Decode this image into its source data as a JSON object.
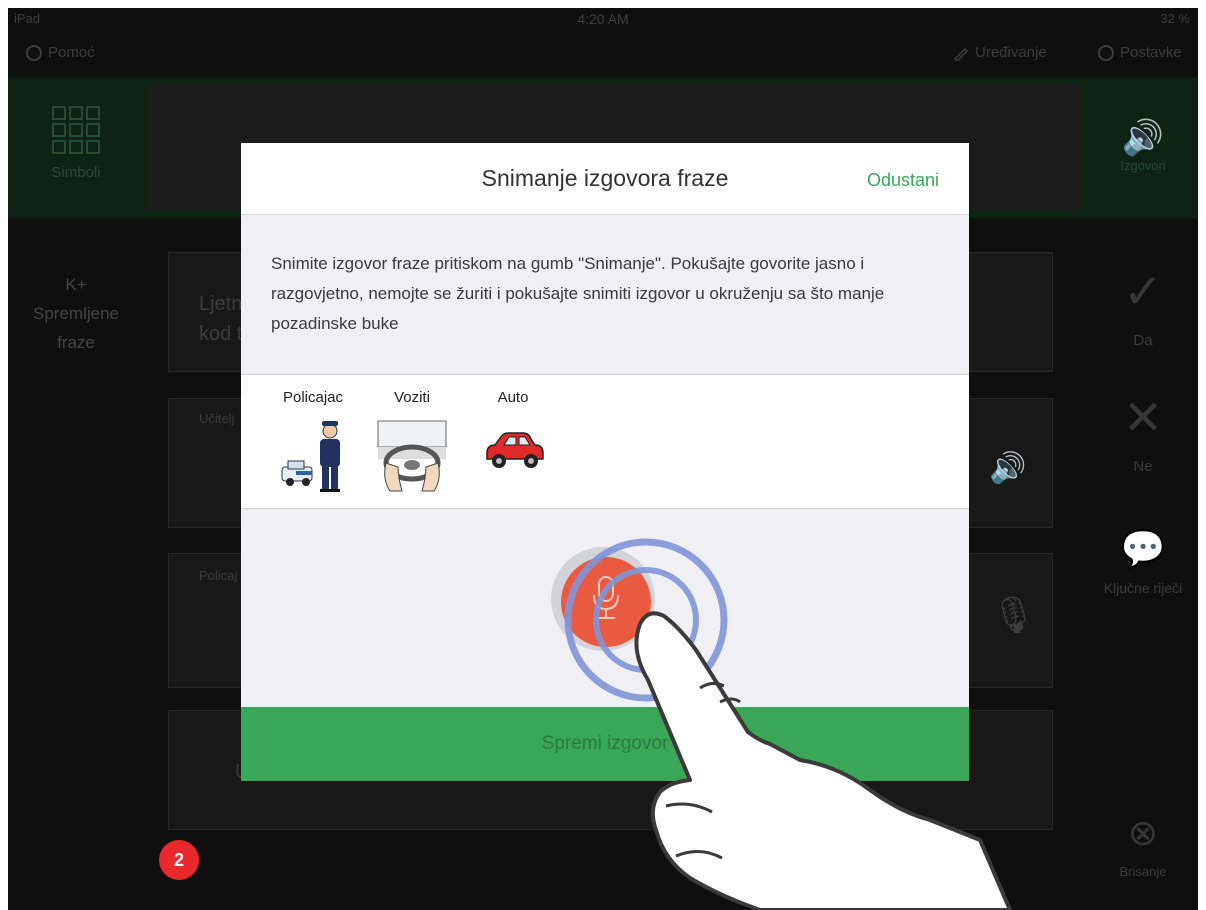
{
  "status_bar": {
    "carrier": "iPad",
    "time": "4:20 AM",
    "battery": "32 %"
  },
  "top_nav": {
    "help_label": "Pomoć",
    "edit_label": "Uređivanje",
    "settings_label": "Postavke"
  },
  "header": {
    "symbols_label": "Simboli",
    "speak_label": "Izgovori"
  },
  "left_rail": {
    "saved_phrases_label": "K+\nSpremljene\nfraze"
  },
  "background_cards": {
    "card1_text": "Ljetn\nkod t",
    "card2_label": "Učitelj",
    "card3_label": "Policaj",
    "card4_text": "U"
  },
  "right_rail": {
    "items": [
      {
        "label": "Da",
        "icon": "check-icon"
      },
      {
        "label": "Ne",
        "icon": "x-icon"
      },
      {
        "label": "Ključne riječi",
        "icon": "chat-bubbles-icon"
      },
      {
        "label": "Brisanje",
        "icon": "clear-icon"
      }
    ]
  },
  "badge": {
    "value": "2"
  },
  "modal": {
    "title": "Snimanje izgovora fraze",
    "cancel_label": "Odustani",
    "instructions": "Snimite izgovor fraze pritiskom na gumb \"Snimanje\". Pokušajte govorite jasno i razgovjetno, nemojte se žuriti i pokušajte snimiti izgovor u okruženju sa što manje pozadinske buke",
    "symbols": [
      {
        "label": "Policajac",
        "icon": "policeman-icon"
      },
      {
        "label": "Voziti",
        "icon": "driving-icon"
      },
      {
        "label": "Auto",
        "icon": "car-icon"
      }
    ],
    "save_label": "Spremi izgovor"
  },
  "colors": {
    "accent_green": "#3aa657",
    "record_red": "#ea5a40",
    "badge_red": "#e8282c"
  }
}
